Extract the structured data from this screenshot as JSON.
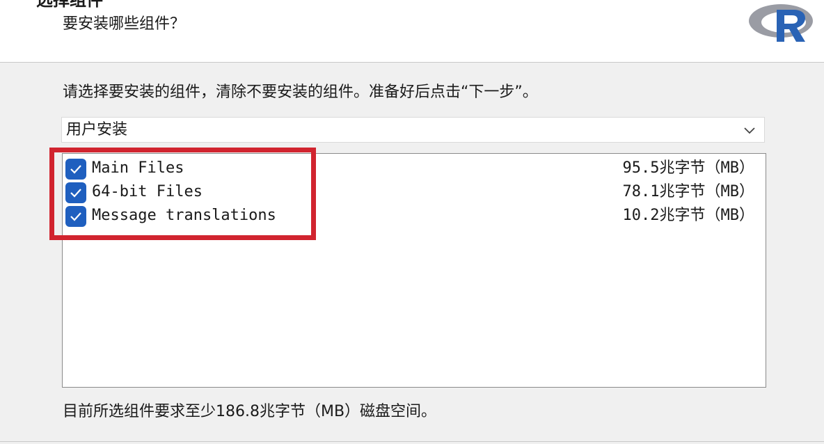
{
  "header": {
    "title": "选择组件",
    "subtitle": "要安装哪些组件？"
  },
  "instruction": "请选择要安装的组件，清除不要安装的组件。准备好后点击“下一步”。",
  "install_type": {
    "selected": "用户安装"
  },
  "components": [
    {
      "name": "Main Files",
      "size": "95.5兆字节（MB）",
      "checked": true
    },
    {
      "name": "64-bit Files",
      "size": "78.1兆字节（MB）",
      "checked": true
    },
    {
      "name": "Message translations",
      "size": "10.2兆字节（MB）",
      "checked": true
    }
  ],
  "disk_requirement": "目前所选组件要求至少186.8兆字节（MB）磁盘空间。",
  "colors": {
    "checkbox": "#1f5fbf",
    "highlight": "#d1242f",
    "logo_ring": "#9a9ca4",
    "logo_letter": "#2a63b5"
  },
  "icons": {
    "logo": "r-logo",
    "dropdown": "chevron-down-icon",
    "check": "checkmark-icon"
  }
}
